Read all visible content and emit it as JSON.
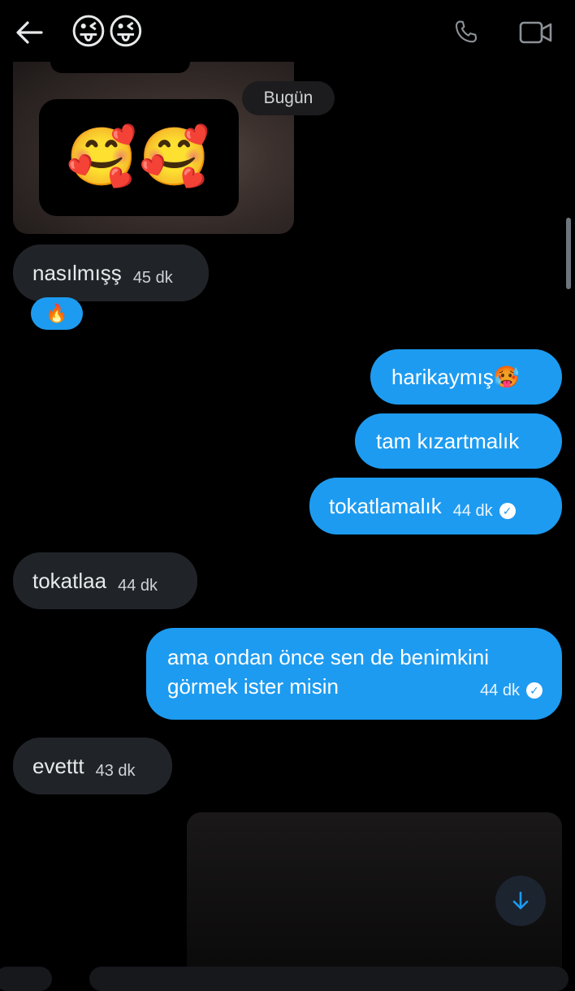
{
  "header": {
    "title_emojis": "😜😜",
    "back_icon": "arrow-left-icon",
    "call_icon": "phone-icon",
    "video_icon": "video-camera-icon"
  },
  "media_top": {
    "sticker_emojis": "🥰🥰"
  },
  "date_separator": "Bugün",
  "messages": [
    {
      "side": "in",
      "text": "nasılmışş",
      "time": "45 dk",
      "reaction": "🔥"
    },
    {
      "side": "out",
      "text": "harikaymış🥵"
    },
    {
      "side": "out",
      "text": "tam kızartmalık"
    },
    {
      "side": "out",
      "text": "tokatlamalık",
      "time": "44 dk",
      "read": true
    },
    {
      "side": "in",
      "text": "tokatlaa",
      "time": "44 dk"
    },
    {
      "side": "out",
      "line1": "ama ondan önce sen de benimkini",
      "line2": "görmek ister misin",
      "time": "44 dk",
      "read": true
    },
    {
      "side": "in",
      "text": "evettt",
      "time": "43 dk"
    }
  ],
  "colors": {
    "background": "#000000",
    "incoming_bubble": "#202327",
    "outgoing_bubble": "#1d9bf0"
  },
  "scroll_icon": "arrow-down-icon"
}
